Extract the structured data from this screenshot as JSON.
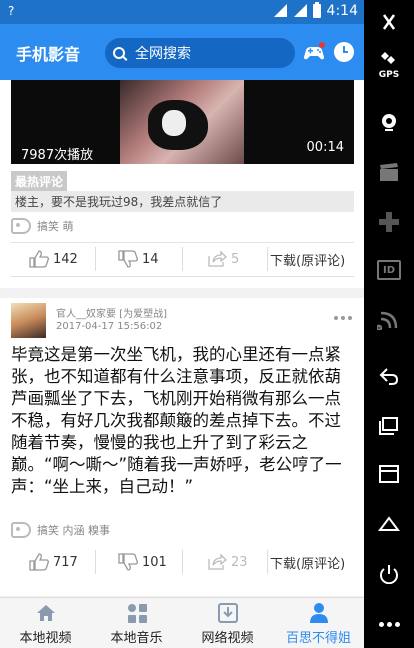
{
  "status_bar": {
    "time": "4:14"
  },
  "app_bar": {
    "title": "手机影音",
    "search_placeholder": "全网搜索"
  },
  "feed": {
    "card1": {
      "play_count": "7987次播放",
      "duration": "00:14",
      "hot_comment_label": "最热评论",
      "hot_comment_text": "楼主，要不是我玩过98，我差点就信了",
      "tags": "搞笑 萌",
      "likes": "142",
      "dislikes": "14",
      "shares": "5",
      "download_label": "下载(原评论)"
    },
    "card2": {
      "username": "官人__奴家要 [为爱塑战]",
      "date": "2017-04-17 15:56:02",
      "text": "毕竟这是第一次坐飞机，我的心里还有一点紧张，也不知道都有什么注意事项，反正就依葫芦画瓢坐了下去，飞机刚开始稍微有那么一点不稳，有好几次我都颠簸的差点掉下去。不过随着节奏，慢慢的我也上升了到了彩云之巅。“啊～嘶～”随着我一声娇呼，老公哼了一声：“坐上来，自己动！”",
      "tags": "搞笑 内涵 糗事",
      "likes": "717",
      "dislikes": "101",
      "shares": "23",
      "download_label": "下载(原评论)"
    }
  },
  "bottom_nav": [
    {
      "label": "本地视频",
      "icon": "home-icon",
      "active": false
    },
    {
      "label": "本地音乐",
      "icon": "grid-icon",
      "active": false
    },
    {
      "label": "网络视频",
      "icon": "download-icon",
      "active": false
    },
    {
      "label": "百思不得姐",
      "icon": "person-icon",
      "active": true
    }
  ],
  "system_sidebar": {
    "gps_label": "GPS",
    "id_label": "ID"
  },
  "colors": {
    "primary": "#2d8cef",
    "status_bar": "#1e72c8",
    "search_bg": "#1567c4"
  }
}
